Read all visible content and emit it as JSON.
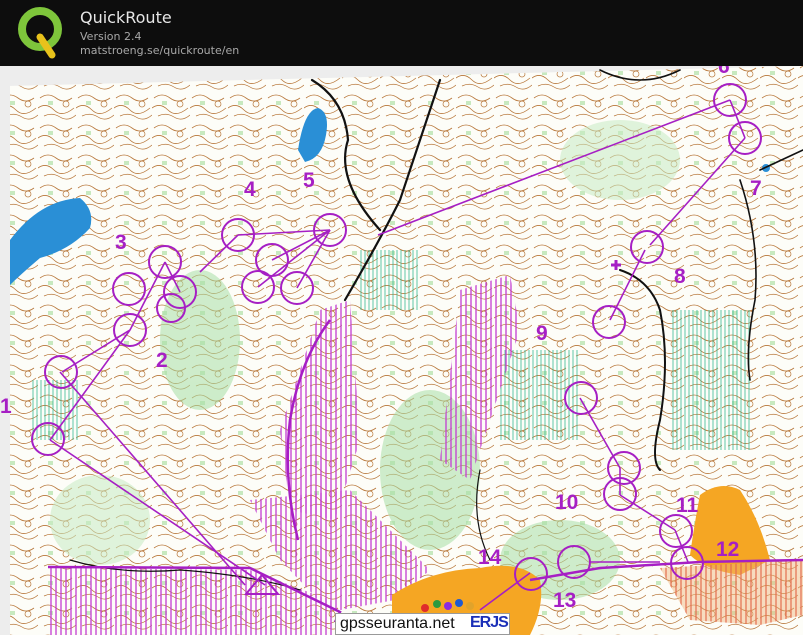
{
  "app": {
    "title": "QuickRoute",
    "version": "Version 2.4",
    "url": "matstroeng.se/quickroute/en"
  },
  "colors": {
    "header_bg": "#0d0d0d",
    "course_purple": "#a61fc4",
    "water_blue": "#2a8fd6",
    "forbidden_magenta": "#c23bd1",
    "open_land_orange": "#f5a623",
    "contour_brown": "#b5651d",
    "vegetation_green": "#8fd18a"
  },
  "course": {
    "controls": [
      {
        "number": "1"
      },
      {
        "number": "2"
      },
      {
        "number": "3"
      },
      {
        "number": "4"
      },
      {
        "number": "5"
      },
      {
        "number": "6"
      },
      {
        "number": "7"
      },
      {
        "number": "8"
      },
      {
        "number": "9"
      },
      {
        "number": "10"
      },
      {
        "number": "11"
      },
      {
        "number": "12"
      },
      {
        "number": "13"
      },
      {
        "number": "14"
      }
    ]
  },
  "watermark": {
    "text": "gpsseuranta.net",
    "logo": "ERJS"
  },
  "icons": [
    "quickroute-logo-icon",
    "start-triangle-icon"
  ]
}
